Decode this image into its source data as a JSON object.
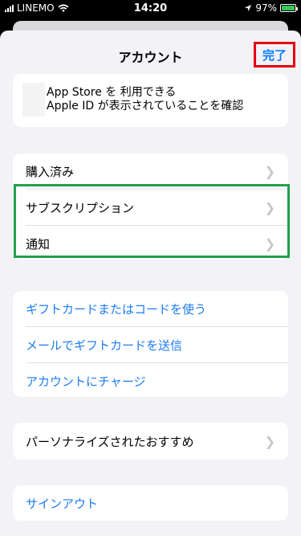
{
  "status_bar": {
    "carrier": "LINEMO",
    "time": "14:20",
    "battery_percent": "97%",
    "battery_level": 0.97,
    "icons": [
      "signal-icon",
      "wifi-icon",
      "location-icon",
      "battery-icon"
    ]
  },
  "header": {
    "title": "アカウント",
    "done_label": "完了"
  },
  "apple_id": {
    "line1": "App Store を 利用できる",
    "line2": "Apple ID が表示されていることを確認"
  },
  "account_list": [
    {
      "label": "購入済み"
    },
    {
      "label": "サブスクリプション"
    },
    {
      "label": "通知"
    }
  ],
  "gift_list": [
    {
      "label": "ギフトカードまたはコードを使う"
    },
    {
      "label": "メールでギフトカードを送信"
    },
    {
      "label": "アカウントにチャージ"
    }
  ],
  "recommend": {
    "label": "パーソナライズされたおすすめ"
  },
  "signout": {
    "label": "サインアウト"
  },
  "colors": {
    "accent": "#1b7cf2",
    "highlight_red": "#e60012",
    "highlight_green": "#1ea24b",
    "background": "#f2f2f7"
  }
}
